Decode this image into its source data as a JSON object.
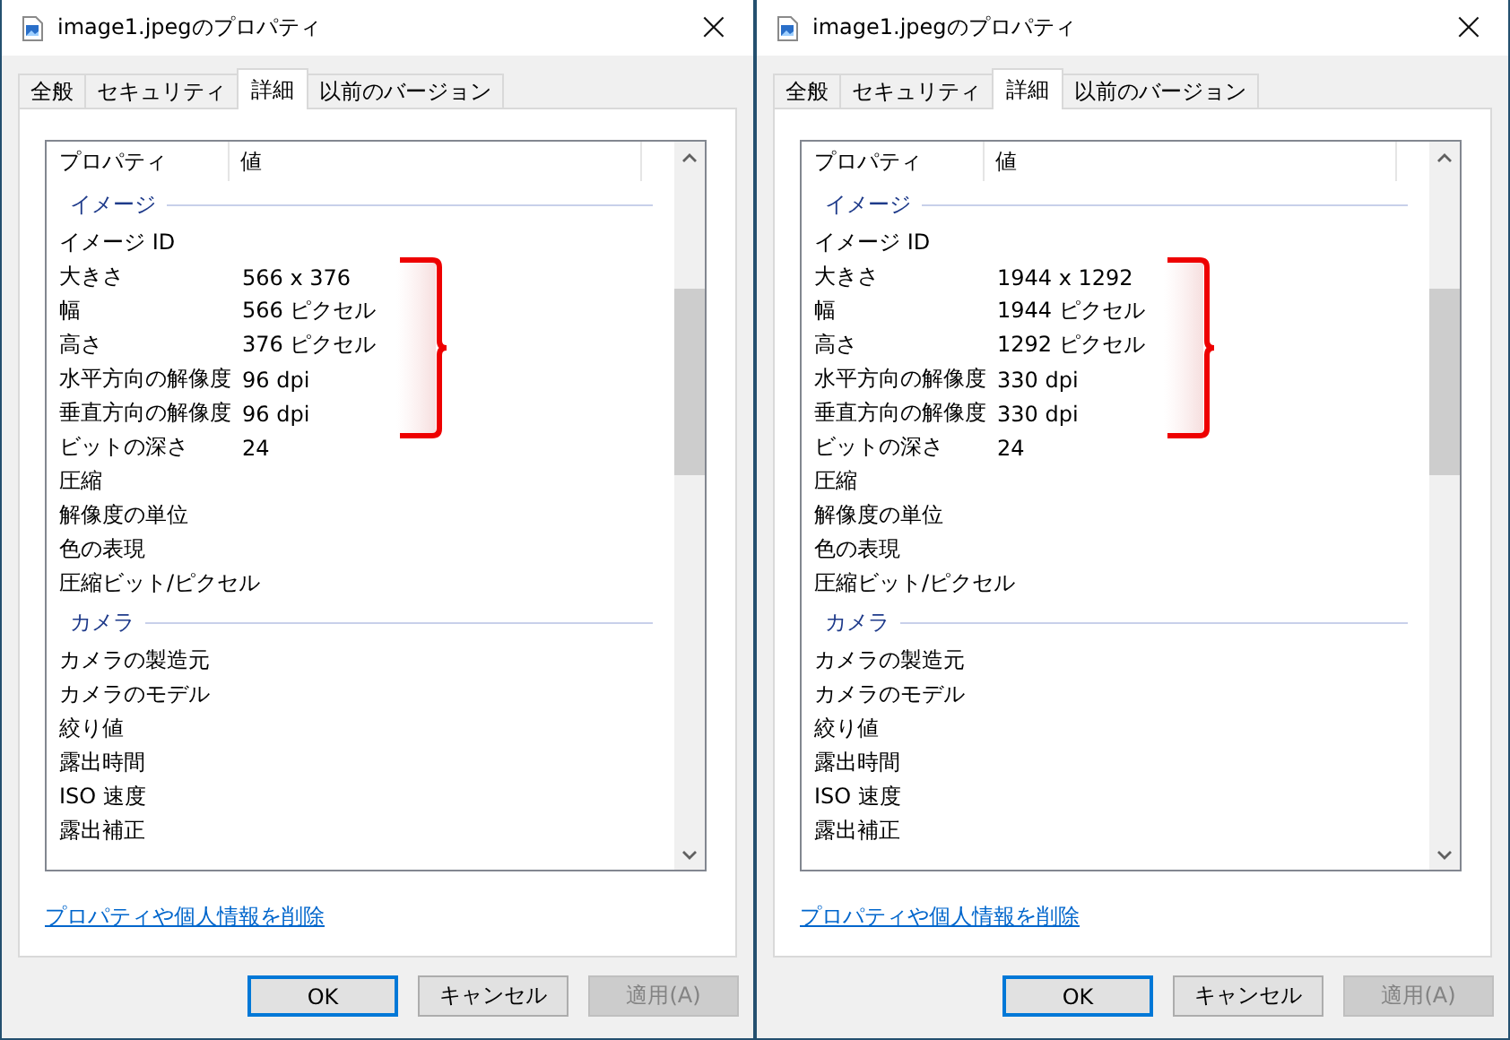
{
  "dialogs": [
    {
      "title": "image1.jpegのプロパティ",
      "close": "×",
      "tabs": [
        {
          "label": "全般",
          "selected": false
        },
        {
          "label": "セキュリティ",
          "selected": false
        },
        {
          "label": "詳細",
          "selected": true
        },
        {
          "label": "以前のバージョン",
          "selected": false
        }
      ],
      "columns": [
        "プロパティ",
        "値"
      ],
      "groups": [
        {
          "title": "イメージ",
          "rows": [
            {
              "name": "イメージ ID",
              "bracketed": false
            },
            {
              "name": "大きさ",
              "value": "566 x 376",
              "bracketed": true
            },
            {
              "name": "幅",
              "value": "566 ピクセル",
              "bracketed": true
            },
            {
              "name": "高さ",
              "value": "376 ピクセル",
              "bracketed": true
            },
            {
              "name": "水平方向の解像度",
              "value": "96 dpi",
              "bracketed": true
            },
            {
              "name": "垂直方向の解像度",
              "value": "96 dpi",
              "bracketed": true
            },
            {
              "name": "ビットの深さ",
              "value": "24",
              "bracketed": false
            },
            {
              "name": "圧縮",
              "bracketed": false
            },
            {
              "name": "解像度の単位",
              "bracketed": false
            },
            {
              "name": "色の表現",
              "bracketed": false
            },
            {
              "name": "圧縮ビット/ピクセル",
              "bracketed": false
            }
          ]
        },
        {
          "title": "カメラ",
          "rows": [
            {
              "name": "カメラの製造元",
              "bracketed": false
            },
            {
              "name": "カメラのモデル",
              "bracketed": false
            },
            {
              "name": "絞り値",
              "bracketed": false
            },
            {
              "name": "露出時間",
              "bracketed": false
            },
            {
              "name": "ISO 速度",
              "bracketed": false
            },
            {
              "name": "露出補正",
              "bracketed": false
            }
          ]
        }
      ],
      "link": "プロパティや個人情報を削除",
      "buttons": [
        {
          "label": "OK",
          "default": true,
          "disabled": false
        },
        {
          "label": "キャンセル",
          "default": false,
          "disabled": false
        },
        {
          "label": "適用(A)",
          "default": false,
          "disabled": true
        }
      ]
    },
    {
      "title": "image1.jpegのプロパティ",
      "close": "×",
      "tabs": [
        {
          "label": "全般",
          "selected": false
        },
        {
          "label": "セキュリティ",
          "selected": false
        },
        {
          "label": "詳細",
          "selected": true
        },
        {
          "label": "以前のバージョン",
          "selected": false
        }
      ],
      "columns": [
        "プロパティ",
        "値"
      ],
      "groups": [
        {
          "title": "イメージ",
          "rows": [
            {
              "name": "イメージ ID",
              "bracketed": false
            },
            {
              "name": "大きさ",
              "value": "1944 x 1292",
              "bracketed": true
            },
            {
              "name": "幅",
              "value": "1944 ピクセル",
              "bracketed": true
            },
            {
              "name": "高さ",
              "value": "1292 ピクセル",
              "bracketed": true
            },
            {
              "name": "水平方向の解像度",
              "value": "330 dpi",
              "bracketed": true
            },
            {
              "name": "垂直方向の解像度",
              "value": "330 dpi",
              "bracketed": true
            },
            {
              "name": "ビットの深さ",
              "value": "24",
              "bracketed": false
            },
            {
              "name": "圧縮",
              "bracketed": false
            },
            {
              "name": "解像度の単位",
              "bracketed": false
            },
            {
              "name": "色の表現",
              "bracketed": false
            },
            {
              "name": "圧縮ビット/ピクセル",
              "bracketed": false
            }
          ]
        },
        {
          "title": "カメラ",
          "rows": [
            {
              "name": "カメラの製造元",
              "bracketed": false
            },
            {
              "name": "カメラのモデル",
              "bracketed": false
            },
            {
              "name": "絞り値",
              "bracketed": false
            },
            {
              "name": "露出時間",
              "bracketed": false
            },
            {
              "name": "ISO 速度",
              "bracketed": false
            },
            {
              "name": "露出補正",
              "bracketed": false
            }
          ]
        }
      ],
      "link": "プロパティや個人情報を削除",
      "buttons": [
        {
          "label": "OK",
          "default": true,
          "disabled": false
        },
        {
          "label": "キャンセル",
          "default": false,
          "disabled": false
        },
        {
          "label": "適用(A)",
          "default": false,
          "disabled": true
        }
      ]
    }
  ]
}
